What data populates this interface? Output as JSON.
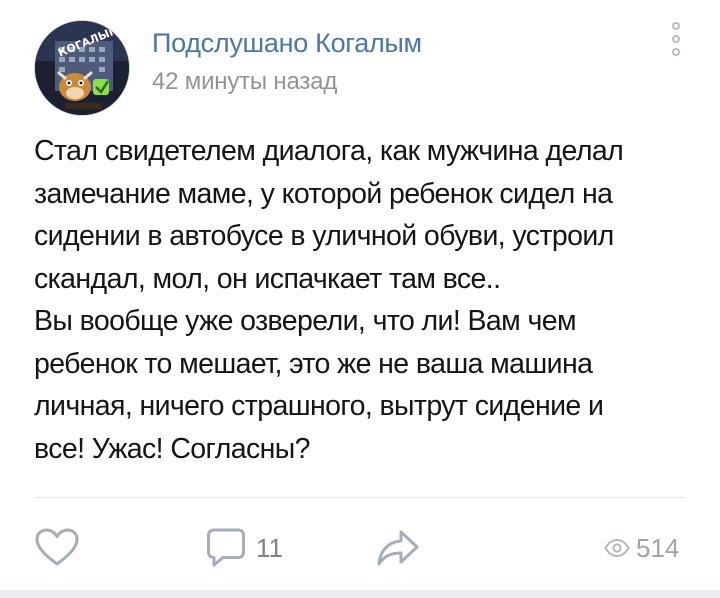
{
  "post": {
    "author": "Подслушано Когалым",
    "time": "42 минуты назад",
    "text_lines": [
      "Стал свидетелем диалога, как мужчина делал",
      "замечание маме, у которой ребенок сидел на",
      "сидении в автобусе в уличной обуви, устроил",
      "скандал, мол, он испачкает там все..",
      "Вы вообще уже озверели, что ли! Вам чем",
      "ребенок то мешает, это же не ваша машина",
      "личная, ничего страшного, вытрут сидение и",
      "все! Ужас! Согласны?"
    ],
    "avatar_text": "КОГАЛЫМ"
  },
  "actions": {
    "comments_count": "11",
    "views_count": "514"
  },
  "icons": {
    "avatar": "community-avatar",
    "menu": "more-vertical-icon",
    "like": "heart-icon",
    "comment": "comment-icon",
    "share": "share-icon",
    "views": "eye-icon"
  },
  "colors": {
    "author": "#4a76a8",
    "meta": "#939393",
    "icon": "#a7adb4"
  }
}
